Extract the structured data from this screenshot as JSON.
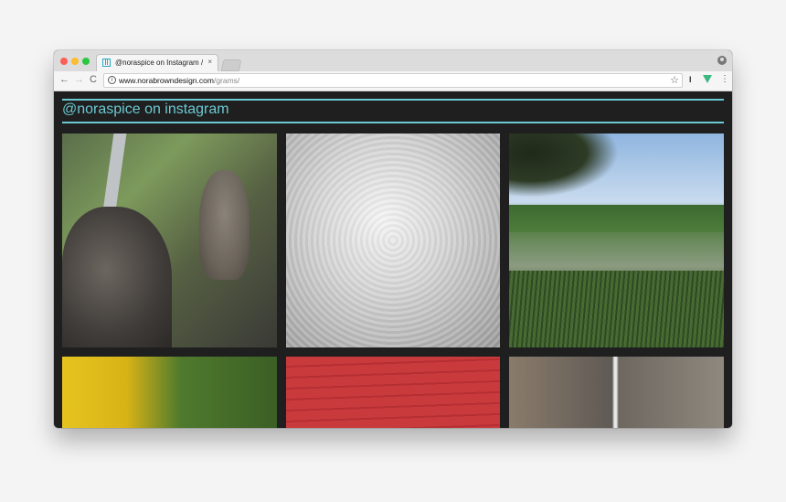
{
  "browser": {
    "tab": {
      "title": "@noraspice on Instagram // Nora",
      "close_glyph": "×"
    },
    "nav": {
      "back_glyph": "←",
      "forward_glyph": "→",
      "reload_glyph": "C"
    },
    "address": {
      "host": "www.norabrowndesign.com",
      "path": "/grams/"
    },
    "bookmark_glyph": "☆",
    "extension_1_glyph": "I",
    "menu_glyph": "⋮",
    "colors": {
      "close": "#fc5f57",
      "minimize": "#fdbb2e",
      "maximize": "#2ac840",
      "accent": "#6cc9d3",
      "page_bg": "#1f1f1f"
    }
  },
  "page": {
    "heading": "@noraspice on instagram",
    "photos": [
      {
        "name": "cat-and-squirrel-photo"
      },
      {
        "name": "clouds-photo"
      },
      {
        "name": "marsh-landscape-photo"
      },
      {
        "name": "yellow-flowers-photo"
      },
      {
        "name": "red-wood-photo"
      },
      {
        "name": "cat-diptych-photo"
      }
    ]
  }
}
